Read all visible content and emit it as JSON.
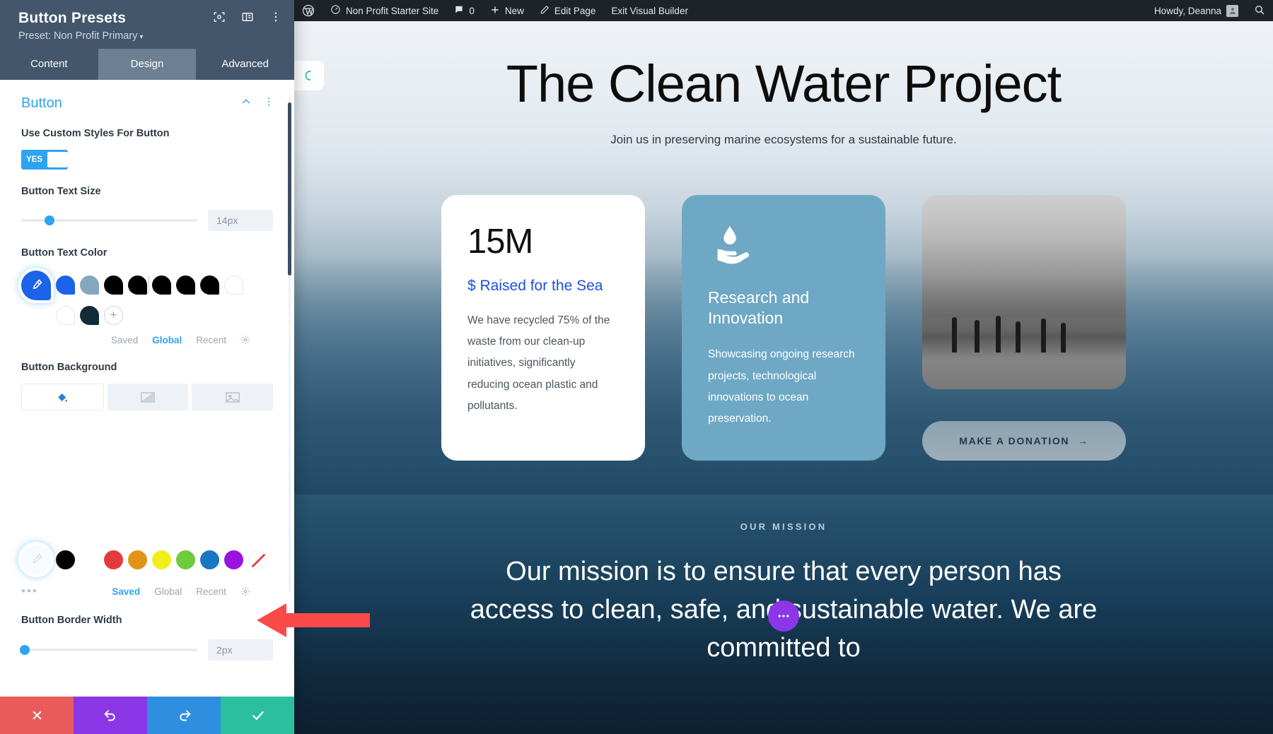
{
  "panel": {
    "title": "Button Presets",
    "preset_label": "Preset: Non Profit Primary",
    "header_icons": [
      {
        "name": "focus-icon"
      },
      {
        "name": "layout-columns-icon"
      },
      {
        "name": "more-vertical-icon"
      }
    ],
    "tabs": [
      {
        "label": "Content",
        "active": false
      },
      {
        "label": "Design",
        "active": true
      },
      {
        "label": "Advanced",
        "active": false
      }
    ],
    "section": {
      "title": "Button",
      "collapse_icon": "chevron-up-icon",
      "more_icon": "more-vertical-icon"
    },
    "fields": {
      "custom_styles": {
        "label": "Use Custom Styles For Button",
        "toggle_value": "YES"
      },
      "text_size": {
        "label": "Button Text Size",
        "value": "14px",
        "slider_percent": 16
      },
      "text_color": {
        "label": "Button Text Color",
        "swatches": [
          "#1b63e8",
          "#85a7bb",
          "#000000",
          "#000000",
          "#000000",
          "#000000",
          "#000000",
          "#ffffff",
          "#ffffff",
          "#132a38"
        ],
        "add_label": "+",
        "source_tabs": [
          {
            "label": "Saved",
            "active": false
          },
          {
            "label": "Global",
            "active": true
          },
          {
            "label": "Recent",
            "active": false
          }
        ],
        "settings_icon": "gear-icon"
      },
      "background": {
        "label": "Button Background",
        "types": [
          {
            "name": "paint-bucket-icon",
            "active": true
          },
          {
            "name": "gradient-icon",
            "active": false
          },
          {
            "name": "image-icon",
            "active": false
          }
        ],
        "palette": [
          "#000000",
          "#ffffff",
          "#e33b3b",
          "#e09416",
          "#f0ee1c",
          "#6ecb3c",
          "#1a76c4",
          "#9a12e0",
          "#ffffff"
        ],
        "more_dots": "•••",
        "source_tabs": [
          {
            "label": "Saved",
            "active": true
          },
          {
            "label": "Global",
            "active": false
          },
          {
            "label": "Recent",
            "active": false
          }
        ],
        "settings_icon": "gear-icon"
      },
      "border_width": {
        "label": "Button Border Width",
        "value": "2px",
        "slider_percent": 2
      }
    },
    "actions": [
      {
        "name": "cancel-button",
        "icon": "x-icon",
        "color": "#eb5b5b"
      },
      {
        "name": "undo-button",
        "icon": "undo-icon",
        "color": "#8b37e8"
      },
      {
        "name": "redo-button",
        "icon": "redo-icon",
        "color": "#2e8fe0"
      },
      {
        "name": "save-button",
        "icon": "check-icon",
        "color": "#2bbfa0"
      }
    ]
  },
  "adminbar": {
    "wp_logo": "wordpress-icon",
    "site_name": "Non Profit Starter Site",
    "comment_count": "0",
    "new_label": "New",
    "edit_page_label": "Edit Page",
    "exit_label": "Exit Visual Builder",
    "howdy": "Howdy, Deanna",
    "search_icon": "search-icon"
  },
  "page": {
    "hero": {
      "title": "The Clean Water Project",
      "subtitle": "Join us in preserving marine ecosystems for a sustainable future."
    },
    "cards": [
      {
        "type": "stat",
        "number": "15M",
        "kicker": "$ Raised for the Sea",
        "body": "We have recycled 75% of the waste from our clean-up initiatives, significantly reducing ocean plastic and pollutants."
      },
      {
        "type": "feature",
        "icon": "water-drop-hand-icon",
        "heading": "Research and Innovation",
        "body": "Showcasing ongoing research projects, technological innovations to ocean preservation."
      },
      {
        "type": "media",
        "image_alt": "beach-photo",
        "button_label": "MAKE A DONATION",
        "button_arrow": "→"
      }
    ],
    "mission": {
      "kicker": "OUR MISSION",
      "text": "Our mission is to ensure that every person has access to clean, safe, and sustainable water. We are committed to"
    },
    "fab_icon": "more-horizontal-icon",
    "side_tab_icon": "divi-logo-icon"
  },
  "annotation": {
    "arrow_color": "#fb4a4a",
    "arrow_name": "red-pointer-arrow"
  }
}
